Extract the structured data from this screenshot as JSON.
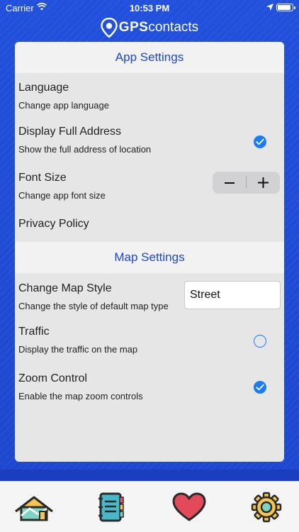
{
  "status_bar": {
    "carrier": "Carrier",
    "time": "10:53 PM"
  },
  "brand": {
    "gps": "GPS",
    "contacts": "contacts"
  },
  "app_settings": {
    "header": "App Settings",
    "language": {
      "title": "Language",
      "subtitle": "Change app language"
    },
    "full_address": {
      "title": "Display Full Address",
      "subtitle": "Show the full address of location",
      "checked": true
    },
    "font_size": {
      "title": "Font Size",
      "subtitle": "Change app font size",
      "minus": "−",
      "plus": "+"
    },
    "privacy": {
      "title": "Privacy Policy"
    }
  },
  "map_settings": {
    "header": "Map Settings",
    "map_style": {
      "title": "Change Map Style",
      "subtitle": "Change the style of default map type",
      "value": "Street"
    },
    "traffic": {
      "title": "Traffic",
      "subtitle": "Display the traffic on the map",
      "checked": false
    },
    "zoom": {
      "title": "Zoom Control",
      "subtitle": "Enable the map zoom controls",
      "checked": true
    }
  },
  "tabs": [
    {
      "icon": "home-map-icon"
    },
    {
      "icon": "contacts-book-icon"
    },
    {
      "icon": "heart-icon"
    },
    {
      "icon": "gear-icon"
    }
  ],
  "colors": {
    "accent": "#1a7cf5",
    "header_text": "#1b47c9",
    "background": "#1f4bd4"
  }
}
